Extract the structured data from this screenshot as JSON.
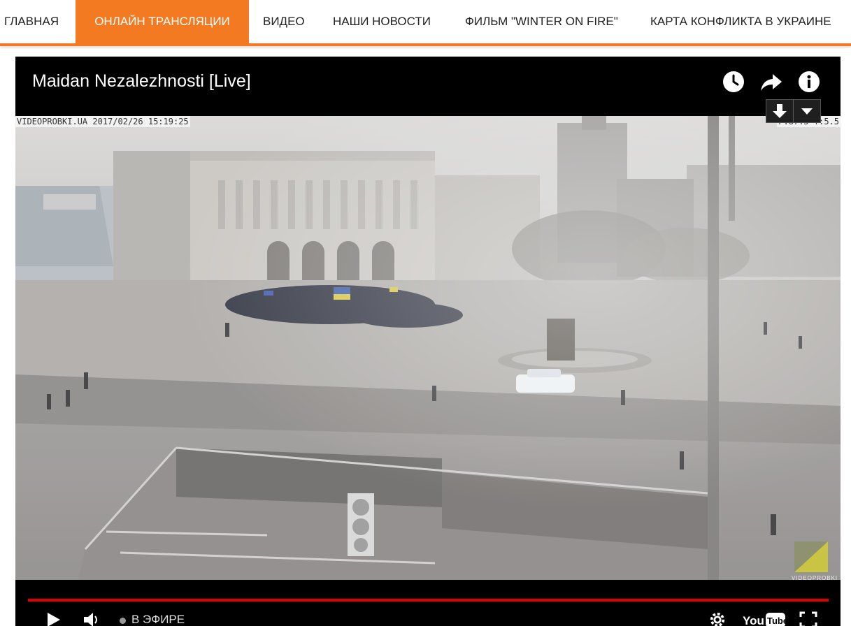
{
  "nav": {
    "items": [
      {
        "label": "ГЛАВНАЯ",
        "active": false
      },
      {
        "label": "ОНЛАЙН ТРАНСЛЯЦИИ",
        "active": true
      },
      {
        "label": "ВИДЕО",
        "active": false
      },
      {
        "label": "НАШИ НОВОСТИ",
        "active": false
      },
      {
        "label": "ФИЛЬМ \"WINTER ON FIRE\"",
        "active": false
      },
      {
        "label": "КАРТА КОНФЛИКТА В УКРАИНЕ",
        "active": false
      }
    ],
    "accent_color": "#f47a22"
  },
  "player": {
    "title": "Maidan Nezalezhnosti [Live]",
    "header_icons": [
      "clock-icon",
      "share-icon",
      "info-icon"
    ],
    "overlay": {
      "timestamp": "VIDEOPROBKI.UA 2017/02/26 15:19:25",
      "camera_info": "P:87.5 T:5.5"
    },
    "extra_buttons": [
      "download-icon",
      "dropdown-arrow-icon"
    ],
    "watermark": "VIDEOPROBKI",
    "controls": {
      "live_label": "В ЭФИРЕ",
      "progress_color": "#e00000",
      "icons": [
        "play-icon",
        "volume-icon",
        "settings-icon",
        "youtube-logo-icon",
        "fullscreen-icon"
      ]
    }
  }
}
